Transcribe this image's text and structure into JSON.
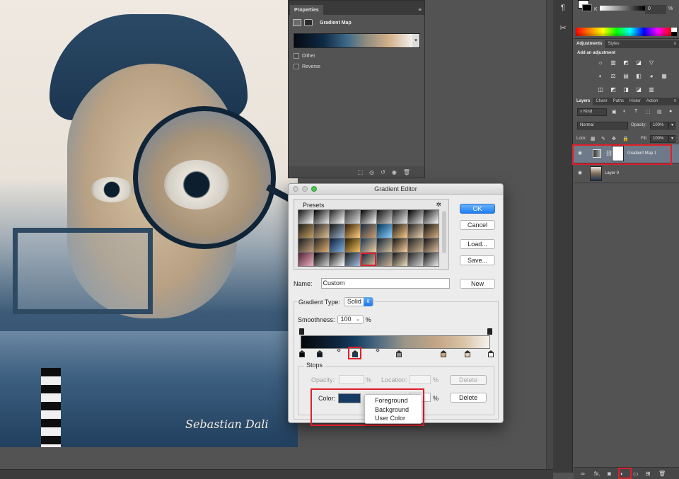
{
  "colors": {
    "accent_highlight": "#e01f2b",
    "ok_button": "#1d7ef2",
    "selected_color_stop": "#173c63"
  },
  "canvas": {
    "signature_text": "Sebastian Dali"
  },
  "properties_panel": {
    "tab_label": "Properties",
    "adjustment_title": "Gradient Map",
    "dither_label": "Dither",
    "reverse_label": "Reverse",
    "menu_icon": "panel-menu-icon"
  },
  "gradient_editor": {
    "title": "Gradient Editor",
    "presets_label": "Presets",
    "ok_label": "OK",
    "cancel_label": "Cancel",
    "load_label": "Load...",
    "save_label": "Save...",
    "new_label": "New",
    "name_label": "Name:",
    "name_value": "Custom",
    "gradient_type_label": "Gradient Type:",
    "gradient_type_value": "Solid",
    "smoothness_label": "Smoothness:",
    "smoothness_value": "100",
    "percent": "%",
    "stops_label": "Stops",
    "opacity_label": "Opacity:",
    "location_label": "Location:",
    "delete_label": "Delete",
    "color_label": "Color:",
    "color_menu": [
      "Foreground",
      "Background",
      "User Color"
    ]
  },
  "color_panel": {
    "channel_label": "K",
    "k_value": "0",
    "percent": "%"
  },
  "adjustments_panel": {
    "tabs": [
      "Adjustments",
      "Styles"
    ],
    "add_label": "Add an adjustment"
  },
  "layers_panel": {
    "tabs": [
      "Layers",
      "Chanr",
      "Paths",
      "Histor",
      "Action"
    ],
    "kind_label": "Kind",
    "blend_mode": "Normal",
    "opacity_label": "Opacity:",
    "opacity_value": "100%",
    "lock_label": "Lock:",
    "fill_label": "Fill:",
    "fill_value": "100%",
    "layers": [
      {
        "name": "Gradient Map 1"
      },
      {
        "name": "Layer 0"
      }
    ],
    "footer_fx": "fx."
  }
}
